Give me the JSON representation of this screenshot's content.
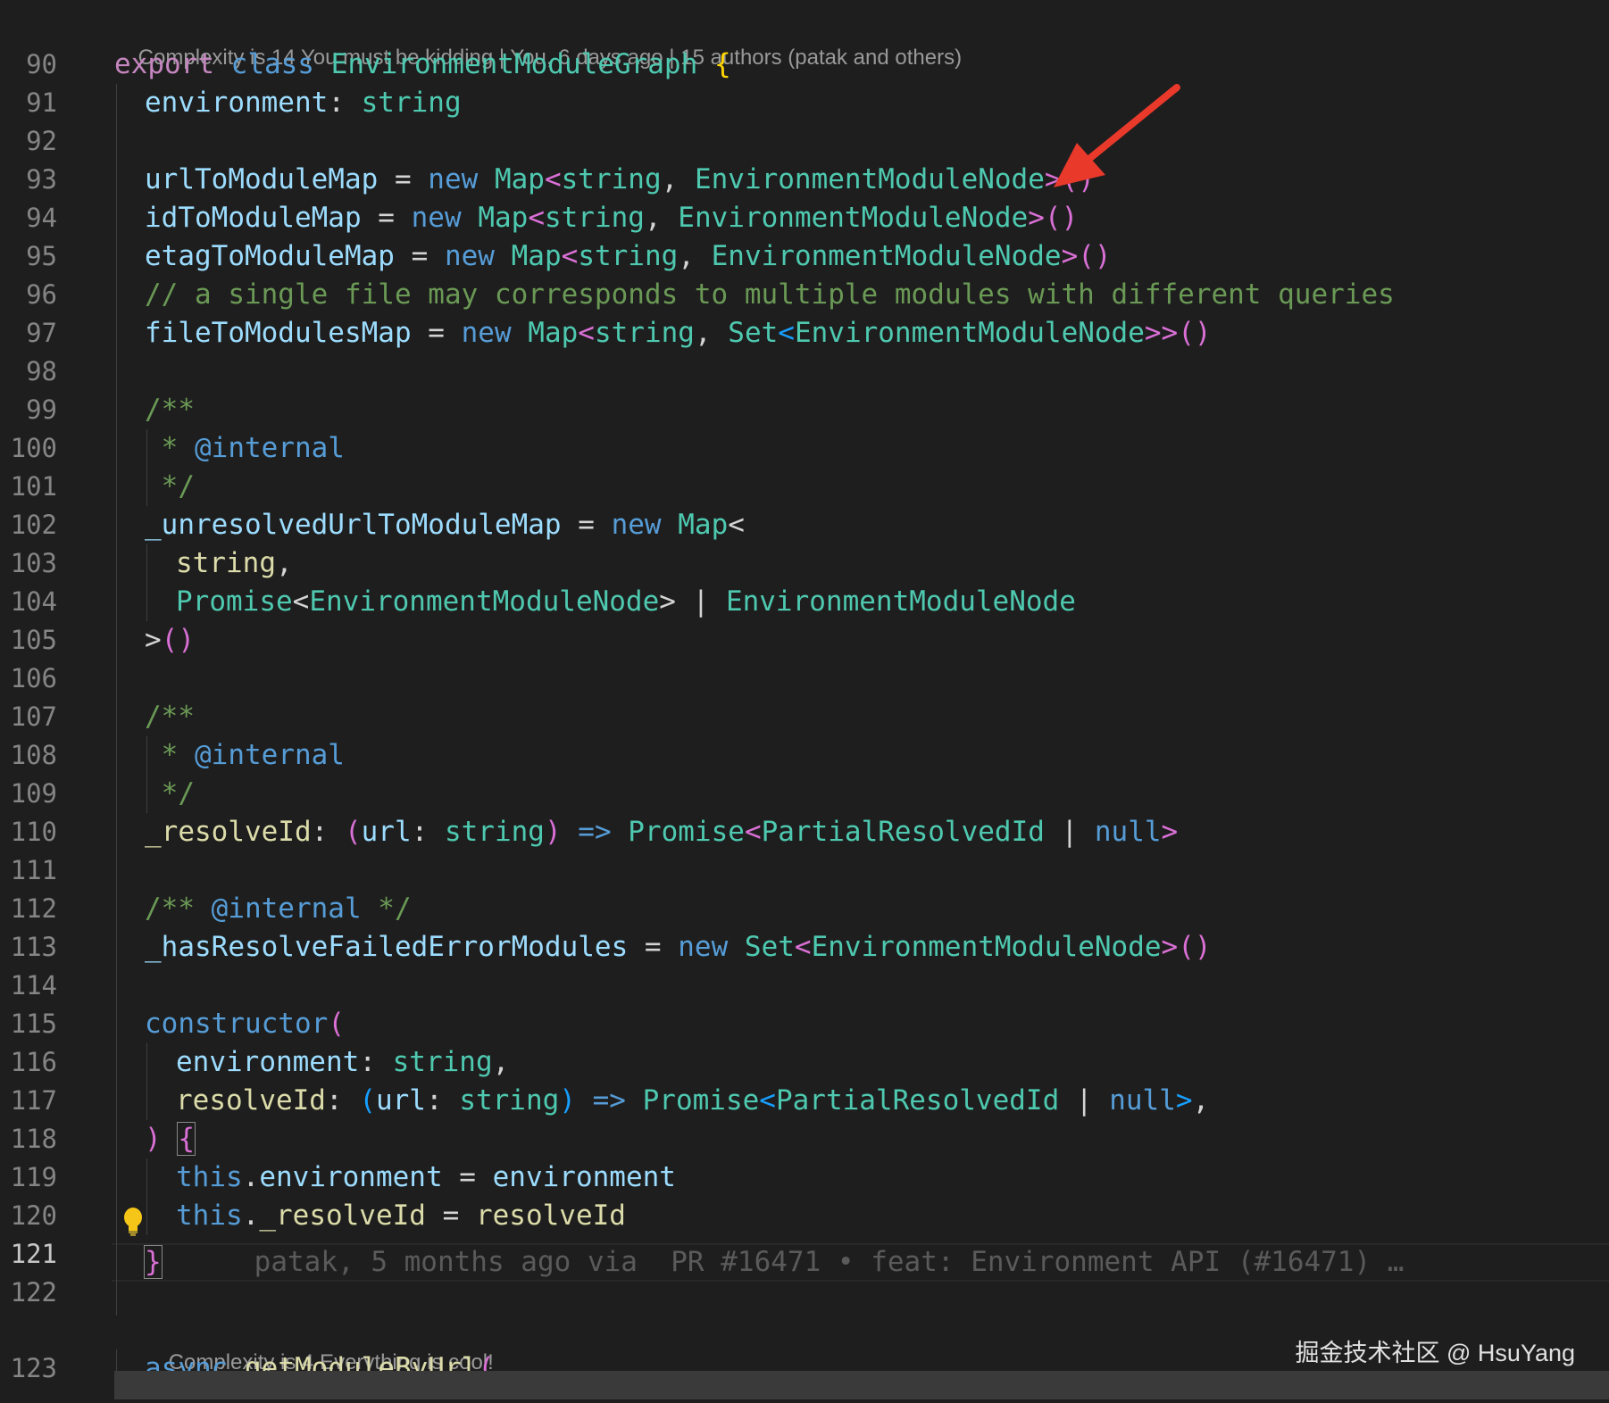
{
  "editor": {
    "code_lens_top": {
      "complexity": "Complexity is 14 You must be kidding",
      "sep1": " | ",
      "author": "You, 6 days ago",
      "sep2": " | ",
      "authors": "15 authors (patak and others)"
    },
    "code_lens_bottom": {
      "complexity": "Complexity is 4 Everything is cool!"
    },
    "blame_inline": "patak, 5 months ago via  PR #16471 • feat: Environment API (#16471) …",
    "line_numbers": [
      "90",
      "91",
      "92",
      "93",
      "94",
      "95",
      "96",
      "97",
      "98",
      "99",
      "100",
      "101",
      "102",
      "103",
      "104",
      "105",
      "106",
      "107",
      "108",
      "109",
      "110",
      "111",
      "112",
      "113",
      "114",
      "115",
      "116",
      "117",
      "118",
      "119",
      "120",
      "121",
      "122",
      "123"
    ],
    "current_line": "121",
    "lines": {
      "l90": [
        "export",
        " ",
        "class",
        " ",
        "EnvironmentModuleGraph",
        " ",
        "{"
      ],
      "l91": [
        "environment",
        ": ",
        "string"
      ],
      "l93": [
        "urlToModuleMap",
        " = ",
        "new",
        " ",
        "Map",
        "<",
        "string",
        ", ",
        "EnvironmentModuleNode",
        ">",
        "()"
      ],
      "l94": [
        "idToModuleMap",
        " = ",
        "new",
        " ",
        "Map",
        "<",
        "string",
        ", ",
        "EnvironmentModuleNode",
        ">",
        "()"
      ],
      "l95": [
        "etagToModuleMap",
        " = ",
        "new",
        " ",
        "Map",
        "<",
        "string",
        ", ",
        "EnvironmentModuleNode",
        ">",
        "()"
      ],
      "l96": [
        "// a single file may corresponds to multiple modules with different queries"
      ],
      "l97": [
        "fileToModulesMap",
        " = ",
        "new",
        " ",
        "Map",
        "<",
        "string",
        ", ",
        "Set",
        "<",
        "EnvironmentModuleNode",
        ">>",
        "()"
      ],
      "l99": [
        "/**"
      ],
      "l100": [
        " * ",
        "@internal"
      ],
      "l101": [
        " */"
      ],
      "l102": [
        "_unresolvedUrlToModuleMap",
        " = ",
        "new",
        " ",
        "Map",
        "<"
      ],
      "l103": [
        "string",
        ","
      ],
      "l104": [
        "Promise",
        "<",
        "EnvironmentModuleNode",
        ">",
        " | ",
        "EnvironmentModuleNode"
      ],
      "l105": [
        ">",
        "()"
      ],
      "l107": [
        "/**"
      ],
      "l108": [
        " * ",
        "@internal"
      ],
      "l109": [
        " */"
      ],
      "l110": [
        "_resolveId",
        ": ",
        "(",
        "url",
        ": ",
        "string",
        ")",
        " => ",
        "Promise",
        "<",
        "PartialResolvedId",
        " | ",
        "null",
        ">"
      ],
      "l112": [
        "/** ",
        "@internal",
        " */"
      ],
      "l113": [
        "_hasResolveFailedErrorModules",
        " = ",
        "new",
        " ",
        "Set",
        "<",
        "EnvironmentModuleNode",
        ">",
        "()"
      ],
      "l115": [
        "constructor",
        "("
      ],
      "l116": [
        "environment",
        ": ",
        "string",
        ","
      ],
      "l117": [
        "resolveId",
        ": ",
        "(",
        "url",
        ": ",
        "string",
        ")",
        " => ",
        "Promise",
        "<",
        "PartialResolvedId",
        " | ",
        "null",
        ">",
        ","
      ],
      "l118": [
        ")",
        " ",
        "{"
      ],
      "l119": [
        "this",
        ".",
        "environment",
        " = ",
        "environment"
      ],
      "l120": [
        "this",
        ".",
        "_resolveId",
        " = ",
        "resolveId"
      ],
      "l121": [
        "}"
      ],
      "l123": [
        "async",
        " ",
        "getModuleByUrl",
        "("
      ]
    }
  },
  "watermark": "掘金技术社区 @ HsuYang",
  "icons": {
    "lightbulb": "lightbulb-icon",
    "arrow": "annotation-arrow"
  },
  "colors": {
    "background": "#1e1e1e",
    "arrow": "#e8392b",
    "lightbulb": "#f5c518"
  }
}
